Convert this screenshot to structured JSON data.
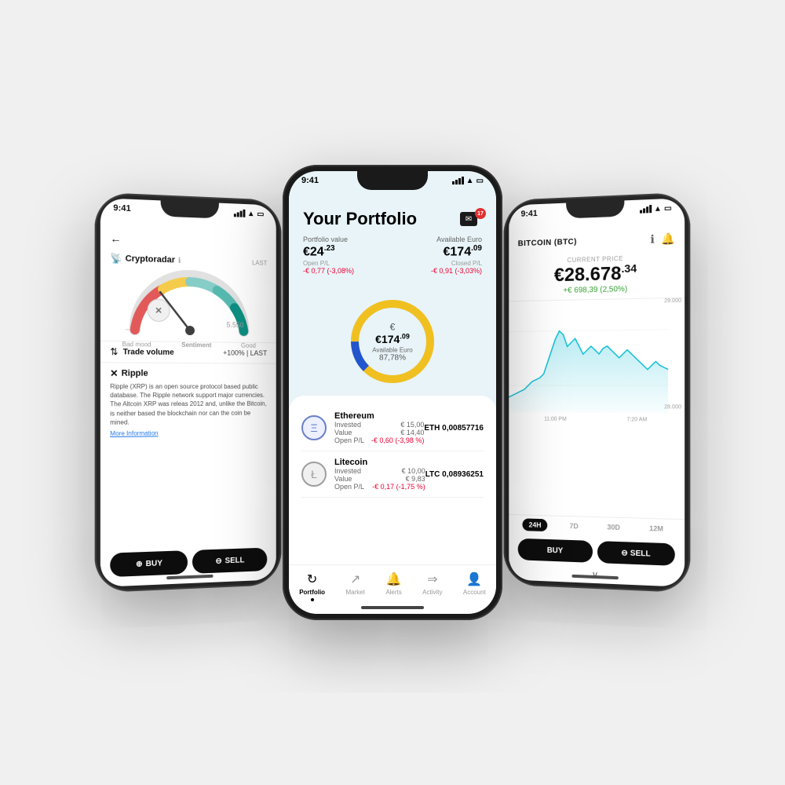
{
  "scene": {
    "background": "#f0f0f0"
  },
  "center_phone": {
    "status_bar": {
      "time": "9:41",
      "signal": "full",
      "wifi": true,
      "battery": "full"
    },
    "notification": {
      "count": "17"
    },
    "header": {
      "title": "Your Portfolio"
    },
    "portfolio_value": {
      "label": "Portfolio value",
      "main": "€24",
      "decimal": ".23"
    },
    "available_euro": {
      "label": "Available Euro",
      "main": "€174",
      "decimal": ".09"
    },
    "open_pl": {
      "label": "Open P/L",
      "value": "-€ 0,77 (-3,08%)"
    },
    "closed_pl": {
      "label": "Closed P/L",
      "value": "-€ 0,91 (-3,03%)"
    },
    "donut": {
      "euro_symbol": "€",
      "value": "€174",
      "decimal": ".09",
      "label": "Available Euro",
      "percentage": "87,78%"
    },
    "holdings": [
      {
        "name": "Ethereum",
        "ticker_amount": "ETH 0,00857716",
        "invested_label": "Invested",
        "invested_value": "€ 15,00",
        "value_label": "Value",
        "value_amount": "€ 14,40",
        "pl_label": "Open P/L",
        "pl_value": "-€ 0,60 (-3,98 %)",
        "icon": "Ξ",
        "icon_class": "coin-eth"
      },
      {
        "name": "Litecoin",
        "ticker_amount": "LTC 0,08936251",
        "invested_label": "Invested",
        "invested_value": "€ 10,00",
        "value_label": "Value",
        "value_amount": "€ 9,83",
        "pl_label": "Open P/L",
        "pl_value": "-€ 0,17 (-1,75 %)",
        "icon": "Ł",
        "icon_class": "coin-ltc"
      }
    ],
    "bottom_nav": [
      {
        "icon": "↻",
        "label": "Portfolio",
        "active": true
      },
      {
        "icon": "↗",
        "label": "Market",
        "active": false
      },
      {
        "icon": "🔔",
        "label": "Alerts",
        "active": false
      },
      {
        "icon": "→",
        "label": "Activity",
        "active": false
      },
      {
        "icon": "👤",
        "label": "Account",
        "active": false
      }
    ]
  },
  "left_phone": {
    "status_bar": {
      "time": "9:41"
    },
    "back_arrow": "←",
    "cryptoradar": {
      "title": "Cryptoradar",
      "info_icon": "ℹ",
      "last_label": "LAST",
      "value": "5.550",
      "sentiment_label": "Sentiment",
      "bad_mood": "Bad mood",
      "good_mood": "Good"
    },
    "trade_volume": {
      "label": "Trade volume",
      "value": "+100% | LAST"
    },
    "ripple": {
      "title": "Ripple",
      "icon": "✕",
      "description": "Ripple (XRP) is an open source protocol based public database. The Ripple network support major currencies. The Altcoin XRP was releas 2012 and, unlike the Bitcoin, is neither based the blockchain nor can the coin be mined.",
      "more_info": "More Information"
    },
    "buy_label": "BUY",
    "sell_label": "SELL"
  },
  "right_phone": {
    "status_bar": {
      "time": "9:41"
    },
    "title": "BITCOIN (BTC)",
    "info_icon": "ℹ",
    "bell_icon": "🔔",
    "current_price_label": "CURRENT PRICE",
    "price_main": "€28.678",
    "price_decimal": ".34",
    "price_change": "+€ 698,39 (2,50%)",
    "chart_y_labels": [
      "29.000",
      "28.000"
    ],
    "chart_x_labels": [
      "11:00 PM",
      "7:20 AM"
    ],
    "time_tabs": [
      "24H",
      "7D",
      "30D",
      "12M"
    ],
    "active_tab": "24H",
    "buy_label": "BUY",
    "sell_label": "SELL",
    "chevron": "∨"
  }
}
